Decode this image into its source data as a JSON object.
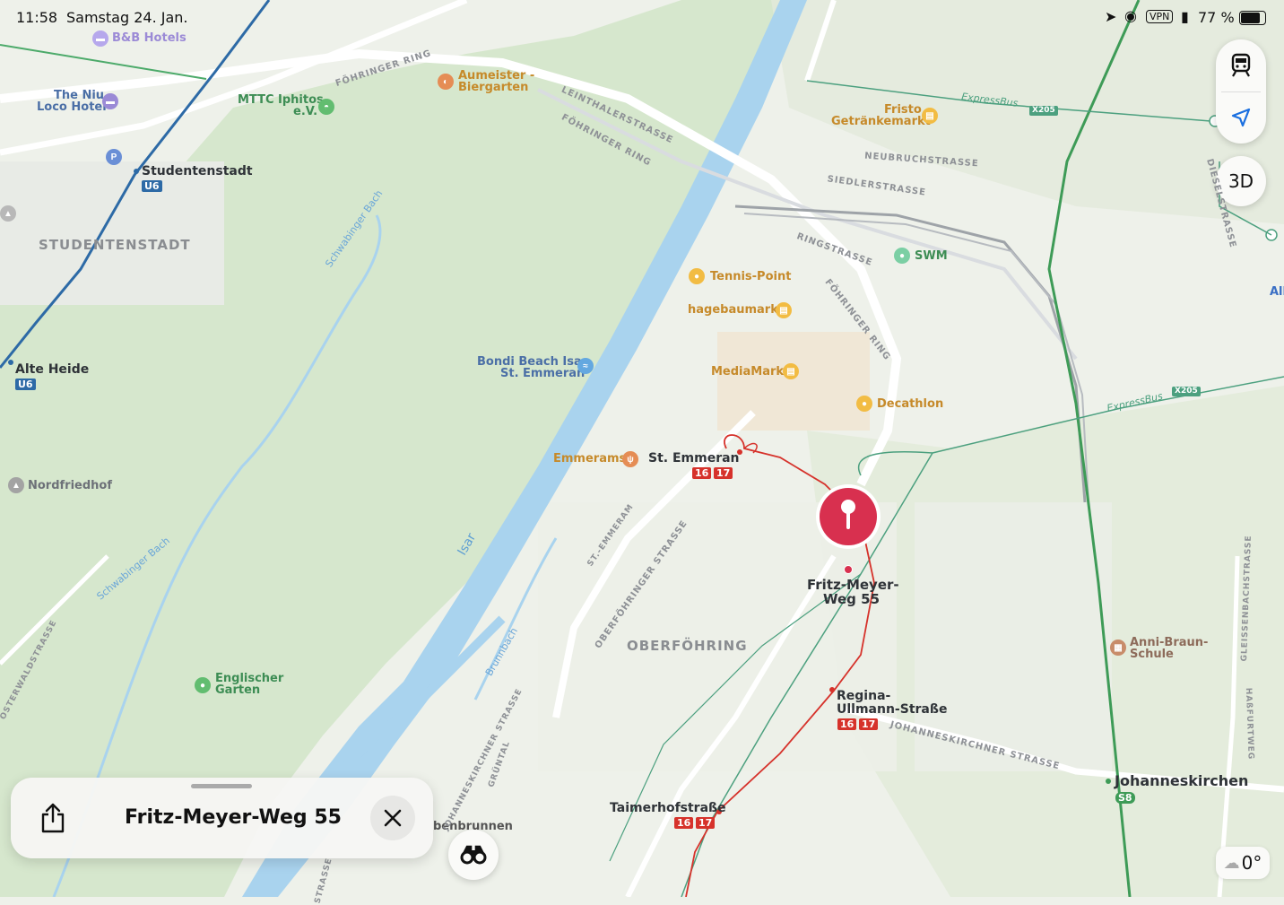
{
  "status_bar": {
    "time": "11:58",
    "date": "Samstag 24. Jan.",
    "vpn": "VPN",
    "battery": "77 %"
  },
  "controls": {
    "three_d": "3D",
    "weather_temp": "0°"
  },
  "place_card": {
    "title": "Fritz-Meyer-Weg 55"
  },
  "pin": {
    "label_line1": "Fritz-Meyer-",
    "label_line2": "Weg 55",
    "color": "#d8304f"
  },
  "pois": {
    "bb_hotels": "B&B Hotels",
    "the_niu_1": "The Niu",
    "the_niu_2": "Loco Hotel",
    "aumeister_1": "Aumeister -",
    "aumeister_2": "Biergarten",
    "mttc_1": "MTTC Iphitos",
    "mttc_2": "e.V.",
    "fristo_1": "Fristo",
    "fristo_2": "Getränkemarkt",
    "swm": "SWM",
    "tennis_point": "Tennis-Point",
    "hagebaumarkt": "hagebaumarkt",
    "mediamarkt": "MediaMarkt",
    "decathlon": "Decathlon",
    "bondi_1": "Bondi Beach Isar",
    "bondi_2": "St. Emmeran",
    "emmerams": "Emmerams",
    "nordfriedhof": "Nordfriedhof",
    "englischer_1": "Englischer",
    "englischer_2": "Garten",
    "anni_1": "Anni-Braun-",
    "anni_2": "Schule",
    "benbrunnen": "benbrunnen",
    "all": "All"
  },
  "transit": {
    "studentenstadt": "Studentenstadt",
    "alte_heide": "Alte Heide",
    "u6": "U6",
    "st_emmeran": "St. Emmeran",
    "regina_1": "Regina-",
    "regina_2": "Ullmann-Straße",
    "taimerhof": "Taimerhofstraße",
    "johanneskirchen": "Johanneskirchen",
    "s8": "S8",
    "tram16": "16",
    "tram17": "17",
    "expressbus": "ExpressBus",
    "x205": "X205"
  },
  "districts": {
    "studentenstadt": "STUDENTENSTADT",
    "oberfoehring": "OBERFÖHRING"
  },
  "streets": {
    "foehringer_ring_top": "FÖHRINGER RING",
    "foehringer_ring_mid": "FÖHRINGER RING",
    "foehringer_ring_right": "FÖHRINGER RING",
    "leinthaler": "LEINTHALERSTRASSE",
    "neubruch": "NEUBRUCHSTRASSE",
    "siedler": "SIEDLERSTRASSE",
    "ring": "RINGSTRASSE",
    "diesel": "DIESELSTRASSE",
    "st_emmeram": "ST.-EMMERAM",
    "oberfoehringer": "OBERFÖHRINGER STRASSE",
    "johanneskirchner": "JOHANNESKIRCHNER STRASSE",
    "gleissenbach": "GLEISSENBACHSTRASSE",
    "hassfurter": "HAßFURTWEG",
    "oesterwald": "OSTERWALDSTRASSE",
    "johanneskirchner_left": "JOHANNESKIRCHNER STRASSE",
    "gruntal": "GRÜNTAL",
    "thalkirchner": "STRASSE"
  },
  "water": {
    "schwabinger_bach_1": "Schwabinger Bach",
    "schwabinger_bach_2": "Schwabinger Bach",
    "isar": "Isar",
    "brunnbach": "Brunnbach"
  },
  "colors": {
    "background": "#eef1ea",
    "park": "#d7e7cf",
    "water": "#a9d3ee",
    "u_line": "#2d6aa6",
    "tram": "#d6322b",
    "s_line": "#3e9b57"
  }
}
